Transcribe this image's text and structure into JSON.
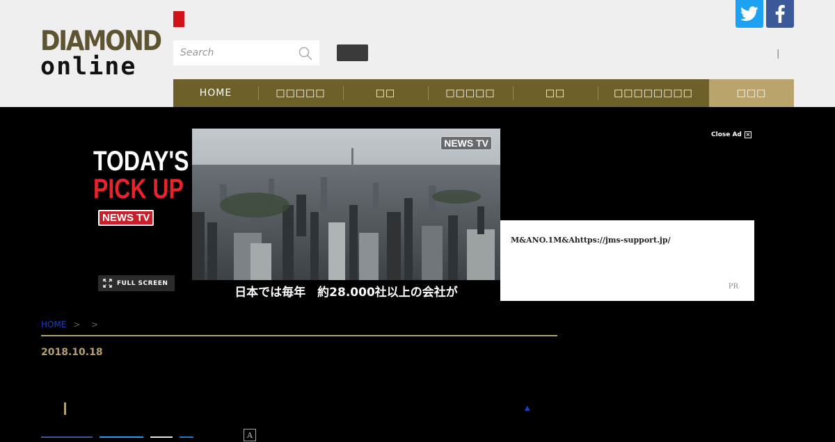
{
  "header": {
    "logo_line1": "DIAMOND",
    "logo_line2": "online",
    "search_placeholder": "Search",
    "separator": "|",
    "social": [
      {
        "name": "twitter",
        "color": "#1da1f2"
      },
      {
        "name": "facebook",
        "color": "#3b5998"
      }
    ],
    "accent_red": "#d0121b"
  },
  "nav": {
    "items": [
      {
        "label": "HOME",
        "active": false
      },
      {
        "label": "□□□□□",
        "active": false
      },
      {
        "label": "□□",
        "active": false
      },
      {
        "label": "□□□□□",
        "active": false
      },
      {
        "label": "□□",
        "active": false
      },
      {
        "label": "□□□□□□□□",
        "active": false
      },
      {
        "label": "□□□",
        "active": true
      }
    ],
    "bg_color": "#6e6029",
    "active_color": "#b9a56b"
  },
  "ad": {
    "title_line1": "TODAY'S",
    "title_line2": "PICK UP",
    "badge": "NEWS TV",
    "full_screen": "FULL SCREEN",
    "video_logo": "NEWS TV",
    "caption": "日本では毎年　約28.000社以上の会社が",
    "close_label": "Close Ad",
    "pr_text": "M&ANO.1M&Ahttps://jms-support.jp/",
    "pr_label": "PR"
  },
  "article": {
    "breadcrumb_home": "HOME",
    "breadcrumb_sep1": ">",
    "breadcrumb_sep2": ">",
    "date": "2018.10.18",
    "accent_gold": "#b3a070",
    "up_arrow": "▲",
    "font_size_label": "A"
  }
}
